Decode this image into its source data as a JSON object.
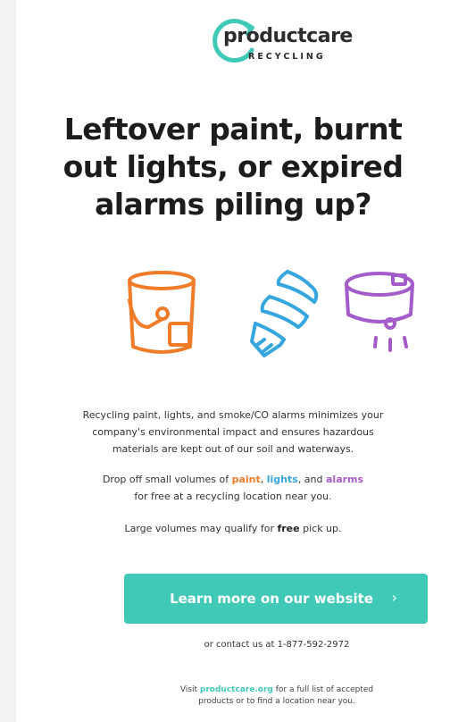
{
  "logo": {
    "main": "productcare",
    "sub": "RECYCLING"
  },
  "headline": {
    "line1": "Leftover paint, burnt",
    "line2": "out lights, or expired",
    "line3": "alarms piling up?"
  },
  "icons": [
    "paint-can-icon",
    "light-bulb-icon",
    "smoke-alarm-icon"
  ],
  "body": {
    "p1_line1": "Recycling paint, lights, and smoke/CO alarms minimizes your",
    "p1_line2": "company's environmental impact and ensures hazardous",
    "p1_line3": "materials are kept out of our soil and waterways.",
    "p2_prefix": "Drop off small volumes of ",
    "p2_paint": "paint",
    "p2_sep1": ", ",
    "p2_lights": "lights",
    "p2_sep2": ", and ",
    "p2_alarms": "alarms",
    "p2_line2": "for free at a recycling location near you.",
    "p3_prefix": "Large volumes may qualify for ",
    "p3_free": "free",
    "p3_suffix": " pick up."
  },
  "cta": {
    "label": "Learn more on our website",
    "chevron": "›"
  },
  "contact": "or contact us at 1-877-592-2972",
  "visit": {
    "prefix": "Visit ",
    "link": "productcare.org",
    "suffix": " for a full list of accepted",
    "line2": "products or to find a location near you."
  },
  "colors": {
    "teal": "#3fc9b6",
    "paint": "#f07c2a",
    "lights": "#36a6df",
    "alarms": "#a35cc9"
  }
}
